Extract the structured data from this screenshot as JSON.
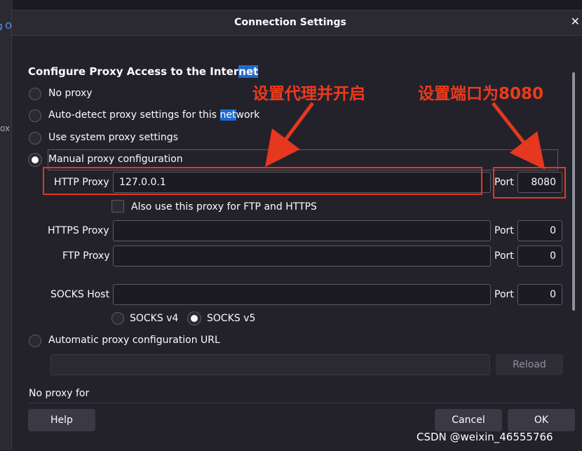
{
  "background": {
    "fragment_top": "g O",
    "fragment_mid": "ox"
  },
  "dialog": {
    "title": "Connection Settings",
    "close_glyph": "✕"
  },
  "section": {
    "heading_pre": "Configure Proxy Access to the Inter",
    "heading_hl": "net"
  },
  "options": {
    "no_proxy": "No proxy",
    "auto_detect_pre": "Auto-detect proxy settings for this ",
    "auto_detect_hl": "net",
    "auto_detect_post": "work",
    "system": "Use system proxy settings",
    "manual": "Manual proxy configuration",
    "auto_url": "Automatic proxy configuration URL"
  },
  "http": {
    "label": "HTTP Proxy",
    "value": "127.0.0.1",
    "port_label": "Port",
    "port_value": "8080"
  },
  "also_use": "Also use this proxy for FTP and HTTPS",
  "https": {
    "label": "HTTPS Proxy",
    "value": "",
    "port_label": "Port",
    "port_value": "0"
  },
  "ftp": {
    "label": "FTP Proxy",
    "value": "",
    "port_label": "Port",
    "port_value": "0"
  },
  "socks": {
    "label": "SOCKS Host",
    "value": "",
    "port_label": "Port",
    "port_value": "0",
    "v4": "SOCKS v4",
    "v5": "SOCKS v5"
  },
  "auto_url_value": "",
  "reload_label": "Reload",
  "no_proxy_for": "No proxy for",
  "buttons": {
    "help": "Help",
    "cancel": "Cancel",
    "ok": "OK"
  },
  "annotations": {
    "left": "设置代理并开启",
    "right": "设置端口为8080"
  },
  "watermark": "CSDN @weixin_46555766",
  "colors": {
    "annotation_red": "#e6371f",
    "highlight_blue": "#1e6ad0",
    "dialog_bg": "#23222b"
  }
}
